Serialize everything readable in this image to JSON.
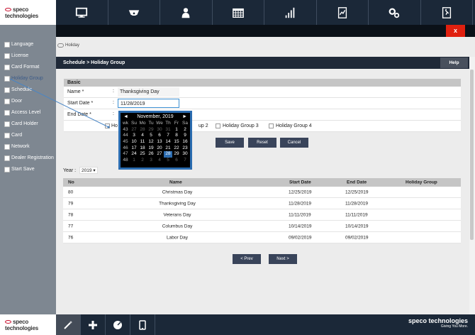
{
  "brand": {
    "name": "speco technologies",
    "tagline": "Giving You More."
  },
  "topnav": [
    {
      "icon": "monitor-icon"
    },
    {
      "icon": "camera-icon"
    },
    {
      "icon": "user-icon"
    },
    {
      "icon": "calendar-icon"
    },
    {
      "icon": "bar-chart-icon"
    },
    {
      "icon": "report-icon"
    },
    {
      "icon": "settings-icon"
    },
    {
      "icon": "exit-icon"
    }
  ],
  "close_label": "x",
  "sidebar": [
    {
      "label": "Language"
    },
    {
      "label": "License"
    },
    {
      "label": "Card Format"
    },
    {
      "label": "Holiday Group"
    },
    {
      "label": "Schedule"
    },
    {
      "label": "Door"
    },
    {
      "label": "Access Level"
    },
    {
      "label": "Card Holder"
    },
    {
      "label": "Card"
    },
    {
      "label": "Network"
    },
    {
      "label": "Dealer Registration"
    },
    {
      "label": "Start Save"
    }
  ],
  "breadcrumb": "Holiday",
  "header": {
    "title": "Schedule > Holiday Group",
    "help": "Help"
  },
  "form": {
    "section": "Basic",
    "name_label": "Name *",
    "name_value": "Thanksgiving Day",
    "start_label": "Start Date *",
    "start_value": "11/28/2019",
    "end_label": "End Date *",
    "colon": ":",
    "groups": [
      "Ho",
      "up 2",
      "Holiday Group 3",
      "Holiday Group 4"
    ],
    "save": "Save",
    "reset": "Reset",
    "cancel": "Cancel"
  },
  "calendar": {
    "prev": "◄",
    "next": "►",
    "month": "November, 2019",
    "header": [
      "wk",
      "Su",
      "Mo",
      "Tu",
      "We",
      "Th",
      "Fr",
      "Sa"
    ],
    "rows": [
      [
        "43",
        "27",
        "28",
        "29",
        "30",
        "31",
        "1",
        "2"
      ],
      [
        "44",
        "3",
        "4",
        "5",
        "6",
        "7",
        "8",
        "9"
      ],
      [
        "45",
        "10",
        "11",
        "12",
        "13",
        "14",
        "15",
        "16"
      ],
      [
        "46",
        "17",
        "18",
        "19",
        "20",
        "21",
        "22",
        "23"
      ],
      [
        "47",
        "24",
        "25",
        "26",
        "27",
        "28",
        "29",
        "30"
      ],
      [
        "48",
        "1",
        "2",
        "3",
        "4",
        "5",
        "6",
        "7"
      ]
    ],
    "selected": "28"
  },
  "year": {
    "label": "Year :",
    "value": "2019 ▾"
  },
  "table": {
    "columns": [
      "No",
      "Name",
      "Start Date",
      "End Date",
      "Holiday Group"
    ],
    "rows": [
      [
        "80",
        "Christmas Day",
        "12/25/2019",
        "12/25/2019",
        ""
      ],
      [
        "79",
        "Thanksgiving Day",
        "11/28/2019",
        "11/28/2019",
        ""
      ],
      [
        "78",
        "Veterans Day",
        "11/11/2019",
        "11/11/2019",
        ""
      ],
      [
        "77",
        "Columbus Day",
        "10/14/2019",
        "10/14/2019",
        ""
      ],
      [
        "76",
        "Labor Day",
        "09/02/2019",
        "09/02/2019",
        ""
      ]
    ]
  },
  "pager": {
    "prev": "< Prev",
    "next": "Next >"
  },
  "bottomnav": [
    {
      "icon": "wand-icon"
    },
    {
      "icon": "plus-icon"
    },
    {
      "icon": "speedometer-icon"
    },
    {
      "icon": "tablet-icon"
    }
  ]
}
